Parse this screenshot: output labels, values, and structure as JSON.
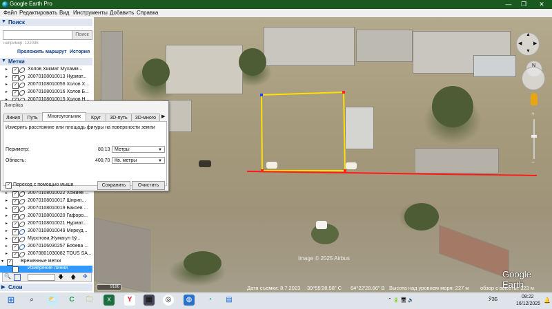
{
  "window": {
    "title": "Google Earth Pro",
    "minimize": "—",
    "maximize": "❐",
    "close": "✕"
  },
  "menu": [
    "Файл",
    "Редактировать",
    "Вид",
    "Инструменты",
    "Добавить",
    "Справка"
  ],
  "search_panel": {
    "title": "Поиск",
    "placeholder": "",
    "button": "Поиск",
    "example": "например: 122036",
    "links": [
      "Проложить маршрут",
      "История"
    ]
  },
  "places_panel": {
    "title": "Метки",
    "items_top": [
      "Холов Хикмат Мухамм...",
      "20070108010013 Нурмат...",
      "20070108010056 Холов Х...",
      "20070108010016 Холов Б...",
      "20070108010015 Холов Н..."
    ],
    "items_bottom": [
      "20070108010022 Хожиев ...",
      "20070108010017 Ширин...",
      "20070108010019 Бакоев ...",
      "20070108010020 Гафоро...",
      "20070108010021 Нурмат...",
      "20070108010049 Меркуд...",
      "Муротова Жумагул бў...",
      "20070106030257 Бобева ...",
      "20070801030082 TOUS SA..."
    ],
    "temp_folder": "Временные метки",
    "selected_item": "Измерение линии"
  },
  "layers_panel": {
    "title": "Слои"
  },
  "ruler": {
    "title": "Линейка",
    "tabs": [
      "Линия",
      "Путь",
      "Многоугольник",
      "Круг",
      "3D-путь",
      "3D-много"
    ],
    "active_tab": "Многоугольник",
    "description": "Измерить расстояние или площадь фигуры на поверхности земли",
    "perimeter_label": "Периметр:",
    "perimeter_value": "80,13",
    "perimeter_unit": "Метры",
    "area_label": "Область:",
    "area_value": "400,70",
    "area_unit": "Кв. метры",
    "mouse_nav_label": "Переход с помощью мыши",
    "save_button": "Сохранить",
    "clear_button": "Очистить"
  },
  "map": {
    "copyright": "Image © 2025 Airbus",
    "brand": "Google Earth",
    "status": {
      "date": "Дата съемки: 8.7.2023",
      "lat": "39°55'28.58\" С",
      "lon": "64°22'28.66\" В",
      "elevation": "Высота над уровнем моря:   227 м",
      "eye": "обзор с высоты:   323 м"
    },
    "measure_colors": {
      "polygon": "#ffe000",
      "line": "#ff1a1a"
    }
  },
  "taskbar": {
    "time": "08:22",
    "date": "16/12/2025",
    "lang": "ЎЗБ"
  }
}
